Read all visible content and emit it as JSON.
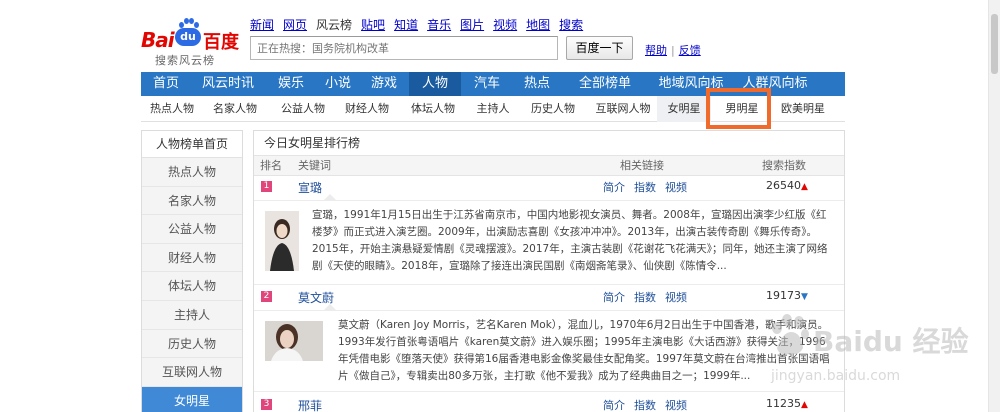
{
  "logo": {
    "text_bai": "Bai",
    "text_du": "du",
    "text_baidu_cn": "百度",
    "subtitle": "搜索风云榜"
  },
  "topnav": [
    "新闻",
    "网页",
    "风云榜",
    "贴吧",
    "知道",
    "音乐",
    "图片",
    "视频",
    "地图",
    "搜索"
  ],
  "topnav_current": "风云榜",
  "search": {
    "placeholder": "正在热搜：国务院机构改革",
    "button": "百度一下",
    "help": "帮助",
    "feedback": "反馈"
  },
  "mainnav": [
    "首页",
    "风云时讯",
    "娱乐",
    "小说",
    "游戏",
    "人物",
    "汽车",
    "热点",
    "全部榜单",
    "地域风向标",
    "人群风向标"
  ],
  "mainnav_active": "人物",
  "subnav": [
    "热点人物",
    "名家人物",
    "公益人物",
    "财经人物",
    "体坛人物",
    "主持人",
    "历史人物",
    "互联网人物",
    "女明星",
    "男明星",
    "欧美明星"
  ],
  "subnav_selected": "女明星",
  "sidebar": {
    "head": "人物榜单首页",
    "items": [
      "热点人物",
      "名家人物",
      "公益人物",
      "财经人物",
      "体坛人物",
      "主持人",
      "历史人物",
      "互联网人物",
      "女明星"
    ],
    "active": "女明星"
  },
  "panel": {
    "title": "今日女明星排行榜",
    "columns": {
      "rank": "排名",
      "keyword": "关键词",
      "related": "相关链接",
      "index": "搜索指数"
    },
    "rows": [
      {
        "rank": "1",
        "name": "宣璐",
        "links": [
          "简介",
          "指数",
          "视频"
        ],
        "index": "26540",
        "trend": "up",
        "detail": "宣璐，1991年1月15日出生于江苏省南京市，中国内地影视女演员、舞者。2008年，宣璐因出演李少红版《红楼梦》而正式进入演艺圈。2009年，出演励志喜剧《女孩冲冲冲》。2013年，出演古装传奇剧《舞乐传奇》。2015年，开始主演悬疑爱情剧《灵魂摆渡》。2017年，主演古装剧《花谢花飞花满天》；同年，她还主演了网络剧《天使的眼睛》。2018年，宣璐除了接连出演民国剧《南烟斋笔录》、仙侠剧《陈情令..."
      },
      {
        "rank": "2",
        "name": "莫文蔚",
        "links": [
          "简介",
          "指数",
          "视频"
        ],
        "index": "19173",
        "trend": "down",
        "detail": "莫文蔚（Karen Joy Morris，艺名Karen Mok），混血儿，1970年6月2日出生于中国香港，歌手和演员。1993年发行首张粤语唱片《karen莫文蔚》进入娱乐圈；1995年主演电影《大话西游》获得关注，1996年凭借电影《堕落天使》获得第16届香港电影金像奖最佳女配角奖。1997年莫文蔚在台湾推出首张国语唱片《做自己》，专辑卖出80多万张，主打歌《他不爱我》成为了经典曲目之一；1999年..."
      },
      {
        "rank": "3",
        "name": "邢菲",
        "links": [
          "简介",
          "指数",
          "视频"
        ],
        "index": "11235",
        "trend": "up"
      }
    ]
  },
  "watermark": {
    "text": "Baidu 经验",
    "url": "jingyan.baidu.com"
  },
  "colors": {
    "nav_blue": "#2977c4",
    "nav_active": "#1a5a9e",
    "sidebar_active": "#3f89d6",
    "rank_badge": "#e0457b",
    "highlight_box": "#f06a2c",
    "logo_red": "#e10602"
  }
}
